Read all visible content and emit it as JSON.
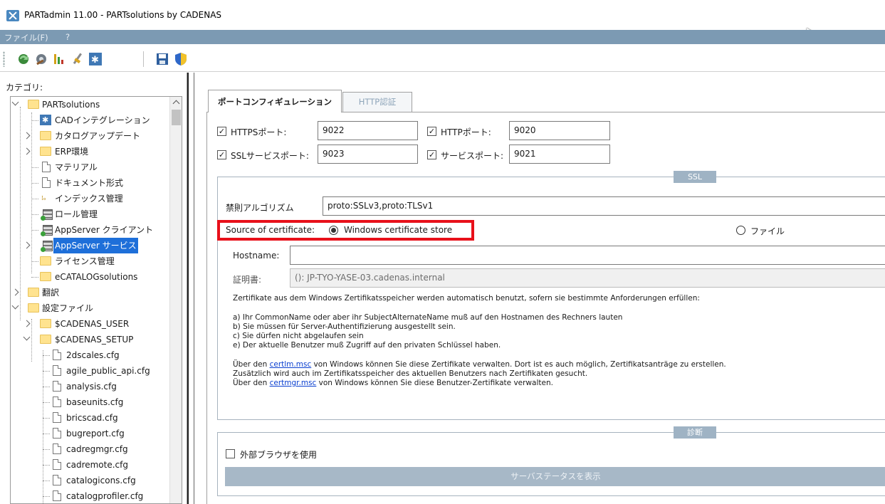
{
  "window": {
    "title": "PARTadmin 11.00 - PARTsolutions by CADENAS"
  },
  "menu": {
    "items": [
      "ファイル(F)",
      "?"
    ]
  },
  "left": {
    "category_label": "カテゴリ:",
    "tree": [
      "PARTsolutions",
      "CADインテグレーション",
      "カタログアップデート",
      "ERP環境",
      "マテリアル",
      "ドキュメント形式",
      "インデックス管理",
      "ロール管理",
      "AppServer クライアント",
      "AppServer サービス",
      "ライセンス管理",
      "eCATALOGsolutions",
      "翻訳",
      "設定ファイル",
      "$CADENAS_USER",
      "$CADENAS_SETUP",
      "2dscales.cfg",
      "agile_public_api.cfg",
      "analysis.cfg",
      "baseunits.cfg",
      "bricscad.cfg",
      "bugreport.cfg",
      "cadregmgr.cfg",
      "cadremote.cfg",
      "catalogicons.cfg",
      "catalogprofiler.cfg"
    ]
  },
  "tabs": {
    "port": "ポートコンフィギュレーション",
    "http": "HTTP認証"
  },
  "ports": {
    "https_label": "HTTPSポート:",
    "https_value": "9022",
    "http_label": "HTTPポート:",
    "http_value": "9020",
    "ssl_label": "SSLサービスポート:",
    "ssl_value": "9023",
    "service_label": "サービスポート:",
    "service_value": "9021"
  },
  "ssl": {
    "title": "SSL",
    "forbidden_label": "禁則アルゴリズム",
    "forbidden_value": "proto:SSLv3,proto:TLSv1",
    "source_label": "Source of certificate:",
    "windows_option": "Windows certificate store",
    "file_option": "ファイル",
    "hostname_label": "Hostname:",
    "hostname_value": "",
    "cert_label": "証明書:",
    "cert_value": "(): JP-TYO-YASE-03.cadenas.internal",
    "info_line1": "Zertifikate aus dem Windows Zertifikatsspeicher werden automatisch benutzt, sofern sie bestimmte Anforderungen erfüllen:",
    "info_a": "a) Ihr CommonName oder aber ihr SubjectAlternateName muß auf den Hostnamen des Rechners lauten",
    "info_b": "b) Sie müssen für Server-Authentifizierung ausgestellt sein.",
    "info_c": "c) Sie dürfen nicht abgelaufen sein",
    "info_e": "e) Der aktuelle Benutzer muß Zugriff auf den privaten Schlüssel haben.",
    "info_link1_pre": "Über den ",
    "info_link1": "certlm.msc",
    "info_link1_post": " von Windows können Sie diese Zertifikate verwalten. Dort ist es auch möglich, Zertifikatsanträge zu erstellen.",
    "info_line_user": "Zusätzlich wird auch im Zertifikatsspeicher des aktuellen Benutzers nach Zertifikaten gesucht.",
    "info_link2_pre": "Über den ",
    "info_link2": "certmgr.msc",
    "info_link2_post": " von Windows können Sie diese Benutzer-Zertifikate verwalten."
  },
  "diag": {
    "title": "診断",
    "external_browser_label": "外部ブラウザを使用",
    "status_button": "サーバステータスを表示"
  },
  "colors": {
    "menubar": "#7c9ab3",
    "accent": "#1e6fd9",
    "highlight": "#e8101a",
    "group_title": "#9fb3c4"
  }
}
